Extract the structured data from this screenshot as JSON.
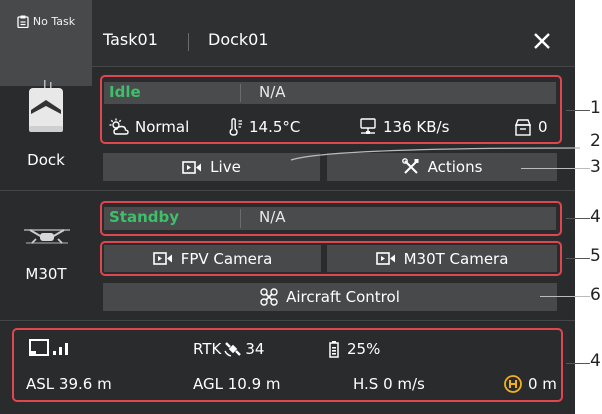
{
  "header": {
    "no_task_label": "No Task",
    "task_name": "Task01",
    "dock_name": "Dock01"
  },
  "dock": {
    "label": "Dock",
    "status": "Idle",
    "status_detail": "N/A",
    "weather": "Normal",
    "temperature": "14.5°C",
    "network_speed": "136 KB/s",
    "storage_count": "0",
    "live_label": "Live",
    "actions_label": "Actions"
  },
  "aircraft": {
    "label": "M30T",
    "status": "Standby",
    "status_detail": "N/A",
    "fpv_camera_label": "FPV Camera",
    "m30t_camera_label": "M30T Camera",
    "aircraft_control_label": "Aircraft Control"
  },
  "telemetry": {
    "rtk_label": "RTK",
    "rtk_count": "34",
    "battery": "25%",
    "asl": "ASL 39.6 m",
    "agl": "AGL 10.9 m",
    "hs": "H.S 0 m/s",
    "home_distance": "0 m"
  },
  "callouts": [
    "1",
    "2",
    "3",
    "4",
    "5",
    "6",
    "4"
  ],
  "colors": {
    "status_green": "#3fbf6a",
    "highlight_red": "#e0464f",
    "home_yellow": "#f2b01e"
  }
}
